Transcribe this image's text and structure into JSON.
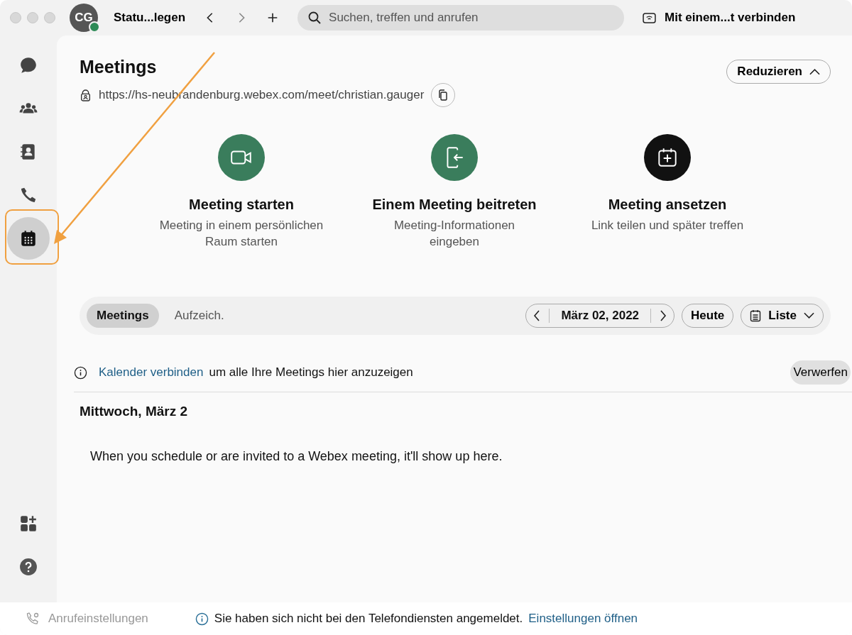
{
  "titlebar": {
    "avatar_initials": "CG",
    "status": "Statu...legen",
    "search": {
      "placeholder": "Suchen, treffen und anrufen"
    },
    "connect": "Mit einem...t verbinden"
  },
  "sidebar": {
    "items": [
      {
        "kind": "chat",
        "selected": false
      },
      {
        "kind": "teams",
        "selected": false
      },
      {
        "kind": "contacts",
        "selected": false
      },
      {
        "kind": "calls",
        "selected": false
      },
      {
        "kind": "calendar",
        "selected": true
      }
    ],
    "bottom": [
      {
        "kind": "apps"
      },
      {
        "kind": "help"
      }
    ]
  },
  "header": {
    "title": "Meetings",
    "url": "https://hs-neubrandenburg.webex.com/meet/christian.gauger",
    "collapse": "Reduzieren"
  },
  "actions": [
    {
      "kind": "start",
      "title": "Meeting starten",
      "subtitle": "Meeting in einem persönlichen Raum starten"
    },
    {
      "kind": "join",
      "title": "Einem Meeting beitreten",
      "subtitle": "Meeting-Informationen eingeben"
    },
    {
      "kind": "schedule",
      "title": "Meeting ansetzen",
      "subtitle": "Link teilen und später treffen"
    }
  ],
  "tabs": [
    {
      "label": "Meetings",
      "selected": true
    },
    {
      "label": "Aufzeich.",
      "selected": false
    }
  ],
  "date": "März 02, 2022",
  "today": "Heute",
  "view": "Liste",
  "notice": {
    "link": "Kalender verbinden",
    "text": "um alle Ihre Meetings hier anzuzeigen",
    "dismiss": "Verwerfen"
  },
  "day_heading": "Mittwoch, März 2",
  "empty_message": "When you schedule or are invited to a Webex meeting, it'll show up here.",
  "footer": {
    "call_settings": "Anrufeinstellungen",
    "message": "Sie haben sich nicht bei den Telefondiensten angemeldet.",
    "link": "Einstellungen öffnen"
  }
}
